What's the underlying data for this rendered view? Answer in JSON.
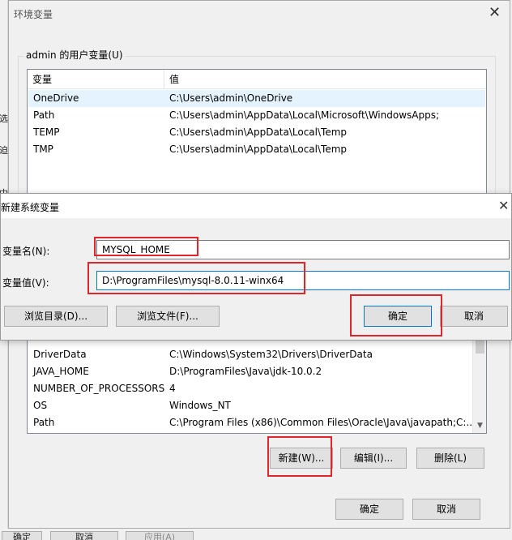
{
  "background_window": {
    "left_chars": [
      "选",
      "迫",
      "中"
    ],
    "bottom_buttons": [
      "确定",
      "取消",
      "应用(A)"
    ]
  },
  "env_dialog": {
    "title": "环境变量",
    "user_group_label": "admin 的用户变量(U)",
    "columns": [
      "变量",
      "值"
    ],
    "user_vars": [
      {
        "name": "OneDrive",
        "value": "C:\\Users\\admin\\OneDrive"
      },
      {
        "name": "Path",
        "value": "C:\\Users\\admin\\AppData\\Local\\Microsoft\\WindowsApps;"
      },
      {
        "name": "TEMP",
        "value": "C:\\Users\\admin\\AppData\\Local\\Temp"
      },
      {
        "name": "TMP",
        "value": "C:\\Users\\admin\\AppData\\Local\\Temp"
      }
    ],
    "system_vars": [
      {
        "name": "DriverData",
        "value": "C:\\Windows\\System32\\Drivers\\DriverData"
      },
      {
        "name": "JAVA_HOME",
        "value": "D:\\ProgramFiles\\Java\\jdk-10.0.2"
      },
      {
        "name": "NUMBER_OF_PROCESSORS",
        "value": "4"
      },
      {
        "name": "OS",
        "value": "Windows_NT"
      },
      {
        "name": "Path",
        "value": "C:\\Program Files (x86)\\Common Files\\Oracle\\Java\\javapath;C:..."
      }
    ],
    "sys_buttons": {
      "new": "新建(W)...",
      "edit": "编辑(I)...",
      "delete": "删除(L)"
    },
    "ok": "确定",
    "cancel": "取消"
  },
  "new_var_dialog": {
    "title": "新建系统变量",
    "name_label": "变量名(N):",
    "name_value": "MYSQL_HOME",
    "value_label": "变量值(V):",
    "value_value": "D:\\ProgramFiles\\mysql-8.0.11-winx64",
    "browse_dir": "浏览目录(D)...",
    "browse_file": "浏览文件(F)...",
    "ok": "确定",
    "cancel": "取消"
  },
  "colors": {
    "highlight": "#e0262a",
    "selection": "#e5f3ff",
    "focus_border": "#0078d7"
  }
}
